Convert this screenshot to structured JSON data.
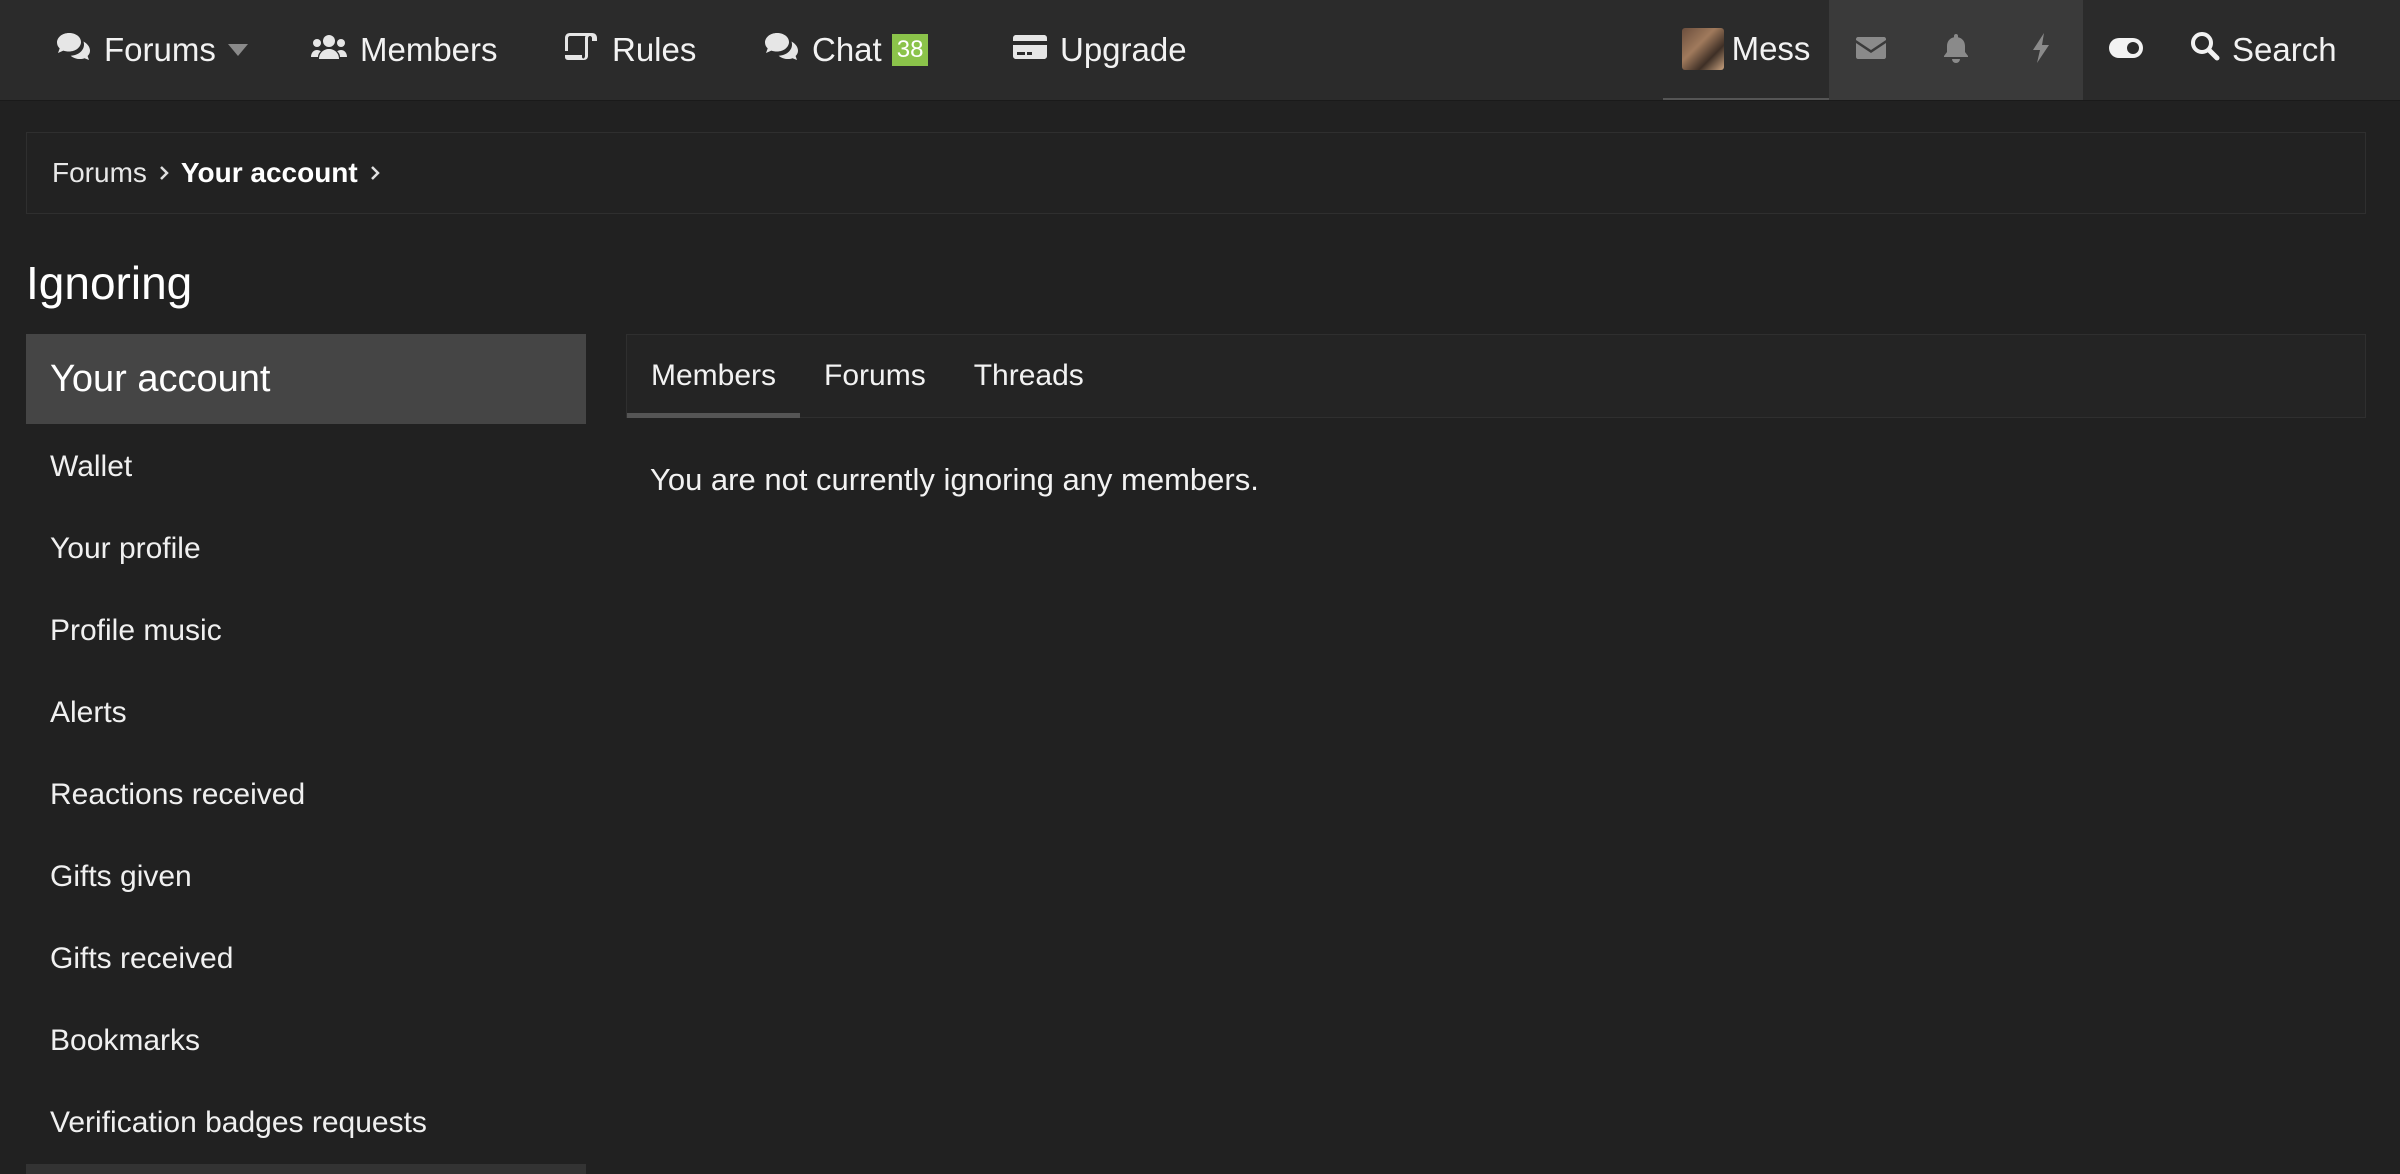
{
  "nav": {
    "forums": "Forums",
    "members": "Members",
    "rules": "Rules",
    "chat": "Chat",
    "chat_badge": "38",
    "upgrade": "Upgrade",
    "user_name": "Mess",
    "search": "Search"
  },
  "breadcrumb": {
    "items": [
      "Forums",
      "Your account"
    ]
  },
  "page": {
    "title": "Ignoring"
  },
  "sidebar": {
    "header": "Your account",
    "items": [
      "Wallet",
      "Your profile",
      "Profile music",
      "Alerts",
      "Reactions received",
      "Gifts given",
      "Gifts received",
      "Bookmarks",
      "Verification badges requests"
    ]
  },
  "tabs": {
    "items": [
      "Members",
      "Forums",
      "Threads"
    ],
    "active": "Members"
  },
  "content": {
    "empty_message": "You are not currently ignoring any members."
  },
  "colors": {
    "background": "#212121",
    "nav_background": "#2b2b2b",
    "badge_green": "#8bc34a",
    "sidebar_header": "#454545"
  }
}
